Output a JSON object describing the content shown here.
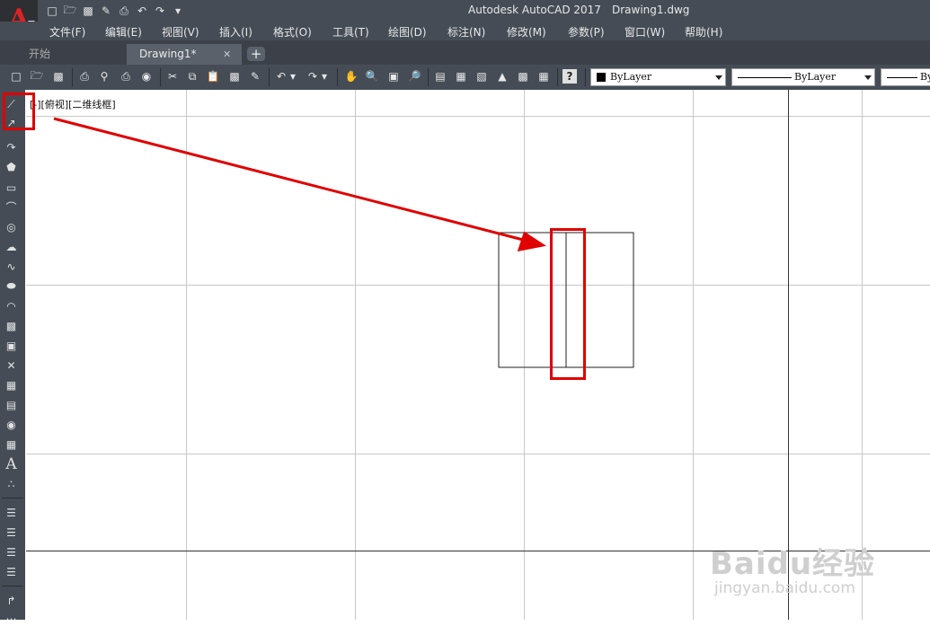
{
  "window": {
    "title": "Autodesk AutoCAD 2017",
    "file": "Drawing1.dwg"
  },
  "menu": [
    "文件(F)",
    "编辑(E)",
    "视图(V)",
    "插入(I)",
    "格式(O)",
    "工具(T)",
    "绘图(D)",
    "标注(N)",
    "修改(M)",
    "参数(P)",
    "窗口(W)",
    "帮助(H)"
  ],
  "tabs": {
    "start": "开始",
    "drawing": "Drawing1*",
    "close": "✕",
    "add": "+"
  },
  "properties": {
    "color": "ByLayer",
    "linetype": "ByLayer",
    "lineweight": "By"
  },
  "viewport": {
    "label": "[-][俯视][二维线框]"
  },
  "watermark": {
    "brand": "Baidu经验",
    "url": "jingyan.baidu.com"
  },
  "colors": {
    "ui_dark": "#454c55",
    "highlight": "#e00000",
    "grid": "#c8c8c8"
  }
}
